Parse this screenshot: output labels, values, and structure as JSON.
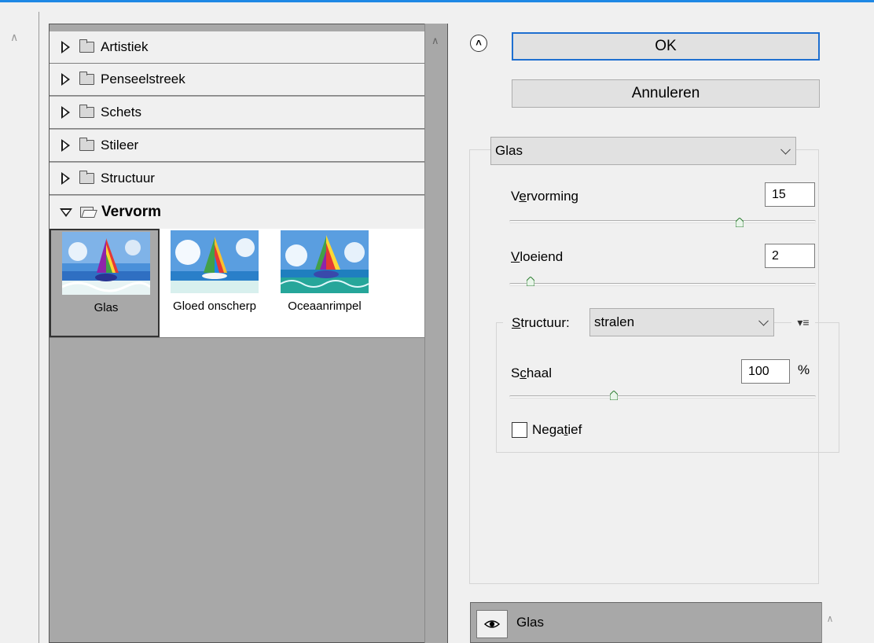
{
  "filter_gallery": {
    "categories": [
      {
        "label": "Artistiek",
        "expanded": false
      },
      {
        "label": "Penseelstreek",
        "expanded": false
      },
      {
        "label": "Schets",
        "expanded": false
      },
      {
        "label": "Stileer",
        "expanded": false
      },
      {
        "label": "Structuur",
        "expanded": false
      },
      {
        "label": "Vervorm",
        "expanded": true
      }
    ],
    "thumbnails": [
      {
        "caption": "Glas",
        "selected": true
      },
      {
        "caption": "Gloed onscherp",
        "selected": false
      },
      {
        "caption": "Oceaanrimpel",
        "selected": false
      }
    ]
  },
  "buttons": {
    "ok_label": "OK",
    "cancel_label": "Annuleren"
  },
  "settings": {
    "filter_selected": "Glas",
    "vervorming": {
      "label_pre": "V",
      "label_u": "e",
      "label_post": "rvorming",
      "value": "15",
      "slider_fraction": 0.75
    },
    "vloeiend": {
      "label_pre": "",
      "label_u": "V",
      "label_post": "loeiend",
      "value": "2",
      "slider_fraction": 0.07
    },
    "structuur": {
      "label_pre": "",
      "label_u": "S",
      "label_post": "tructuur:",
      "value": "stralen"
    },
    "schaal": {
      "label_pre": "S",
      "label_u": "c",
      "label_post": "haal",
      "value": "100",
      "unit": "%",
      "slider_fraction": 0.34
    },
    "negatief": {
      "label_pre": "Nega",
      "label_u": "t",
      "label_post": "ief",
      "checked": false
    }
  },
  "layers": [
    {
      "name": "Glas",
      "visible": true
    }
  ],
  "icons": {
    "collapse": "double-chevron-up-icon",
    "eye": "eye-icon",
    "menu": "panel-menu-icon"
  }
}
